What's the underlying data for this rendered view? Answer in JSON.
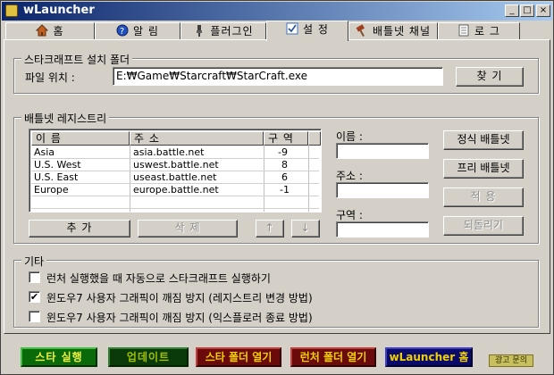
{
  "window": {
    "title": "wLauncher"
  },
  "titlebar_buttons": {
    "minimize": "_",
    "maximize": "□",
    "close": "×"
  },
  "tabs": [
    {
      "label": "홈",
      "icon": "house-icon"
    },
    {
      "label": "알 림",
      "icon": "help-icon"
    },
    {
      "label": "플러그인",
      "icon": "plug-icon"
    },
    {
      "label": "설 정",
      "icon": "checkbox-icon"
    },
    {
      "label": "배틀넷 채널",
      "icon": "hammer-icon"
    },
    {
      "label": "로 그",
      "icon": "document-icon"
    }
  ],
  "install_folder": {
    "legend": "스타크래프트 설치 폴더",
    "path_label": "파일 위치 :",
    "path_value": "E:₩Game₩Starcraft₩StarCraft.exe",
    "find_button": "찾 기"
  },
  "registry": {
    "legend": "배틀넷 레지스트리",
    "columns": [
      "이 름",
      "주 소",
      "구 역"
    ],
    "rows": [
      {
        "name": "Asia",
        "address": "asia.battle.net",
        "zone": "-9"
      },
      {
        "name": "U.S. West",
        "address": "uswest.battle.net",
        "zone": "8"
      },
      {
        "name": "U.S. East",
        "address": "useast.battle.net",
        "zone": "6"
      },
      {
        "name": "Europe",
        "address": "europe.battle.net",
        "zone": "-1"
      }
    ],
    "add_button": "추 가",
    "delete_button": "삭 제",
    "up_button": "↑",
    "down_button": "↓",
    "name_label": "이름 :",
    "address_label": "주소 :",
    "zone_label": "구역 :",
    "name_value": "",
    "address_value": "",
    "zone_value": "",
    "official_button": "정식 배틀넷",
    "free_button": "프리 배틀넷",
    "apply_button": "적 용",
    "revert_button": "되돌리기"
  },
  "misc": {
    "legend": "기타",
    "options": [
      {
        "label": "런처 실행했을 때 자동으로 스타크래프트 실행하기",
        "checked": false
      },
      {
        "label": "윈도우7 사용자 그래픽이 깨짐 방지 (레지스트리 변경 방법)",
        "checked": true
      },
      {
        "label": "윈도우7 사용자 그래픽이 깨짐 방지 (익스플로러 종료 방법)",
        "checked": false
      }
    ]
  },
  "bottom_bar": {
    "run_star": "스타 실행",
    "update": "업데이트",
    "open_star_folder": "스타 폴더 열기",
    "open_launcher_folder": "런처 폴더 열기",
    "wlauncher_home": "wLauncher 홈",
    "ad_text": "광고 문의"
  },
  "colors": {
    "run_star_bg": "#0a6a0a",
    "update_bg": "#0a4a0a",
    "folder_bg": "#6a0a0a",
    "home_bg": "#0a0a6a",
    "gold_text": "#f0d000",
    "green_text": "#f0f040"
  }
}
